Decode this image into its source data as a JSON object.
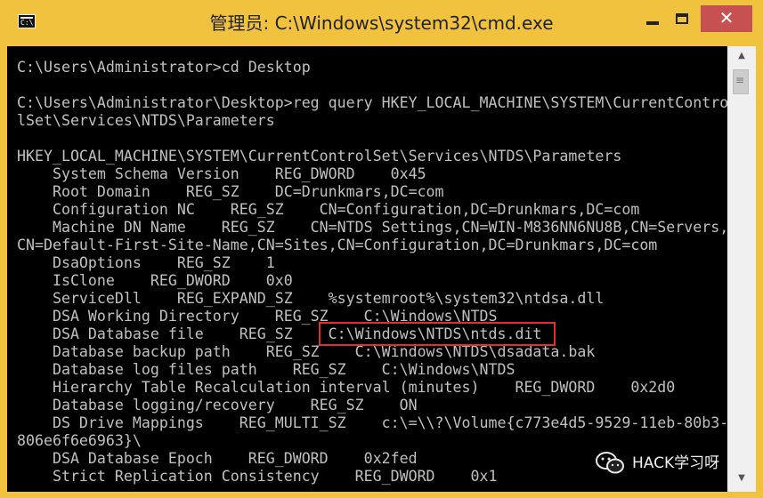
{
  "window": {
    "title": "管理员: C:\\Windows\\system32\\cmd.exe",
    "icon": "cmd-icon",
    "icon_text": "C:\\",
    "accent_color": "#f0c23d",
    "close_color": "#c75050"
  },
  "controls": {
    "minimize": "minimize-icon",
    "maximize": "maximize-icon",
    "close": "✕"
  },
  "console": {
    "lines": [
      "",
      "C:\\Users\\Administrator>cd Desktop",
      "",
      "C:\\Users\\Administrator\\Desktop>reg query HKEY_LOCAL_MACHINE\\SYSTEM\\CurrentContro",
      "lSet\\Services\\NTDS\\Parameters",
      "",
      "HKEY_LOCAL_MACHINE\\SYSTEM\\CurrentControlSet\\Services\\NTDS\\Parameters",
      "    System Schema Version    REG_DWORD    0x45",
      "    Root Domain    REG_SZ    DC=Drunkmars,DC=com",
      "    Configuration NC    REG_SZ    CN=Configuration,DC=Drunkmars,DC=com",
      "    Machine DN Name    REG_SZ    CN=NTDS Settings,CN=WIN-M836NN6NU8B,CN=Servers,",
      "CN=Default-First-Site-Name,CN=Sites,CN=Configuration,DC=Drunkmars,DC=com",
      "    DsaOptions    REG_SZ    1",
      "    IsClone    REG_DWORD    0x0",
      "    ServiceDll    REG_EXPAND_SZ    %systemroot%\\system32\\ntdsa.dll",
      "    DSA Working Directory    REG_SZ    C:\\Windows\\NTDS",
      "    DSA Database file    REG_SZ    C:\\Windows\\NTDS\\ntds.dit",
      "    Database backup path    REG_SZ    C:\\Windows\\NTDS\\dsadata.bak",
      "    Database log files path    REG_SZ    C:\\Windows\\NTDS",
      "    Hierarchy Table Recalculation interval (minutes)    REG_DWORD    0x2d0",
      "    Database logging/recovery    REG_SZ    ON",
      "    DS Drive Mappings    REG_MULTI_SZ    c:\\=\\\\?\\Volume{c773e4d5-9529-11eb-80b3-",
      "806e6f6e6963}\\",
      "    DSA Database Epoch    REG_DWORD    0x2fed",
      "    Strict Replication Consistency    REG_DWORD    0x1"
    ],
    "text_color": "#c0c0c0",
    "background": "#000000",
    "highlight_color": "#e0302a"
  },
  "scrollbar": {
    "up": "▲",
    "down": "▼"
  },
  "watermark": {
    "text": "HACK学习呀",
    "icon": "wechat-icon"
  }
}
